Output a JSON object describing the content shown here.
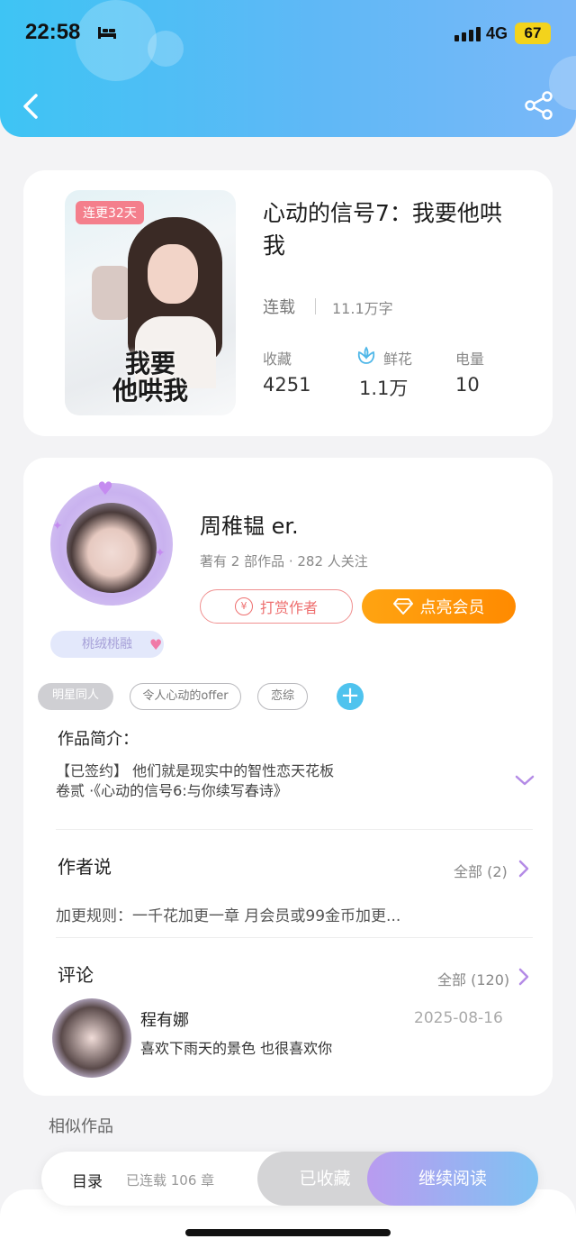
{
  "status_bar": {
    "time": "22:58",
    "network": "4G",
    "battery": "67"
  },
  "book": {
    "cover_badge": "连更32天",
    "cover_title": "我要\n他哄我",
    "title": "心动的信号7：我要他哄我",
    "status": "连载",
    "word_count": "11.1万字",
    "stats": [
      {
        "label": "收藏",
        "value": "4251"
      },
      {
        "label": "鲜花",
        "value": "1.1万"
      },
      {
        "label": "电量",
        "value": "10"
      }
    ]
  },
  "author": {
    "name": "周稚韫 er.",
    "meta": "著有 2 部作品 · 282 人关注",
    "badge": "桃绒桃融",
    "tip_label": "打赏作者",
    "tip_icon_glyph": "¥",
    "vip_label": "点亮会员",
    "tags": [
      "明星同人",
      "令人心动的offer",
      "恋综"
    ]
  },
  "intro": {
    "title": "作品简介：",
    "lines": [
      "【已签约】 他们就是现实中的智性恋天花板",
      "卷贰 ·《心动的信号6:与你续写春诗》"
    ]
  },
  "author_says": {
    "title": "作者说",
    "more": "全部 (2)",
    "text": "加更规则：一千花加更一章 月会员或99金币加更..."
  },
  "comments": {
    "title": "评论",
    "more": "全部 (120)",
    "items": [
      {
        "name": "程有娜",
        "date": "2025-08-16",
        "text": "喜欢下雨天的景色 也很喜欢你"
      }
    ]
  },
  "similar_title": "相似作品",
  "bottom_bar": {
    "toc_label": "目录",
    "chapters": "已连载 106 章",
    "collected_label": "已收藏",
    "read_label": "继续阅读"
  },
  "colors": {
    "header_start": "#3ec4f4",
    "header_end": "#7ab8f8",
    "vip": "#ff8a00",
    "tip": "#ee6f6f",
    "accent_blue": "#4fc3ee"
  }
}
